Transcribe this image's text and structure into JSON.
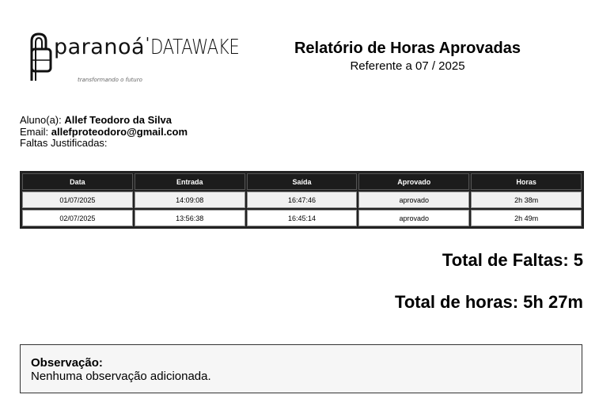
{
  "header": {
    "brand_name": "paranoá",
    "brand_sub": "DATAWAKE",
    "tagline": "transformando o futuro",
    "title": "Relatório de Horas Aprovadas",
    "subtitle": "Referente a 07 / 2025"
  },
  "student": {
    "name_label": "Aluno(a):",
    "name": "Allef Teodoro da Silva",
    "email_label": "Email:",
    "email": "allefproteodoro@gmail.com",
    "justified_label": "Faltas Justificadas:"
  },
  "table": {
    "headers": [
      "Data",
      "Entrada",
      "Saída",
      "Aprovado",
      "Horas"
    ],
    "rows": [
      [
        "01/07/2025",
        "14:09:08",
        "16:47:46",
        "aprovado",
        "2h 38m"
      ],
      [
        "02/07/2025",
        "13:56:38",
        "16:45:14",
        "aprovado",
        "2h 49m"
      ]
    ]
  },
  "totals": {
    "absences": "Total de Faltas: 5",
    "hours": "Total de horas: 5h 27m"
  },
  "observation": {
    "title": "Observação:",
    "text": "Nenhuma observação adicionada."
  },
  "colors": {
    "header_bg": "#1c1c1c",
    "row_alt_bg": "#f1f1f1"
  }
}
